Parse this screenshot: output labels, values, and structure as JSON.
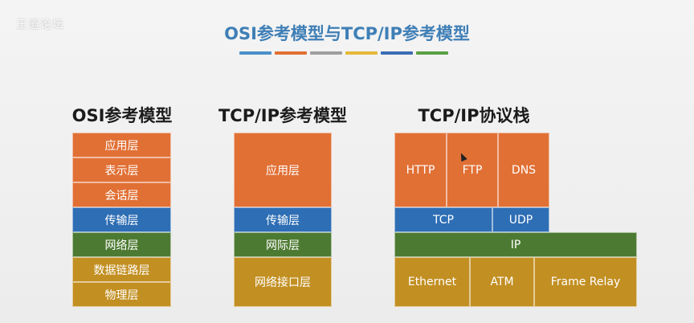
{
  "watermark": "王道论坛",
  "title": "OSI参考模型与TCP/IP参考模型",
  "color_bars": [
    "#4a90c8",
    "#e17035",
    "#9e9e9e",
    "#e5b93a",
    "#3b6db4",
    "#5aa042"
  ],
  "osi": {
    "title": "OSI参考模型",
    "layers": [
      "应用层",
      "表示层",
      "会话层",
      "传输层",
      "网络层",
      "数据链路层",
      "物理层"
    ]
  },
  "tcpip": {
    "title": "TCP/IP参考模型",
    "layers": [
      "应用层",
      "传输层",
      "网际层",
      "网络接口层"
    ]
  },
  "stack": {
    "title": "TCP/IP协议栈",
    "app": [
      "HTTP",
      "FTP",
      "DNS"
    ],
    "transport": [
      "TCP",
      "UDP"
    ],
    "network": "IP",
    "link": [
      "Ethernet",
      "ATM",
      "Frame Relay"
    ]
  }
}
